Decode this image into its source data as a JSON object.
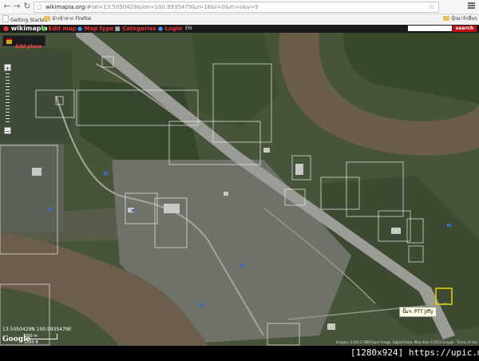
{
  "browser": {
    "url_host": "wikimapia.org",
    "url_rest": "/#lat=13.5050429&lon=100.9935479&z=16&l=0&m=s&v=9",
    "bookmarks": [
      "Getting Started",
      "นำเข้าจาก Firefox",
      "บุ๊กมาร์กอื่นๆ"
    ]
  },
  "wikimapia": {
    "logo": "wikimapia",
    "menu": [
      "Edit map",
      "Map type",
      "Categories",
      "Login"
    ],
    "language": "EN",
    "search_button": "search",
    "search_placeholder": "",
    "add_place": "Add place"
  },
  "map": {
    "coordinates": "13.5050429N 100.9935479E",
    "scale_m": "200 m",
    "scale_ft": "1000 ft",
    "google": "Google",
    "attribution": "Imagery ©2013 CNES/Spot Image, DigitalGlobe, Map data ©2013 Google - Terms of Use",
    "popup_label": "ปั๊มฯ. PTT Jiffy"
  },
  "watermark": "[1280x924] https://upic.me/"
}
